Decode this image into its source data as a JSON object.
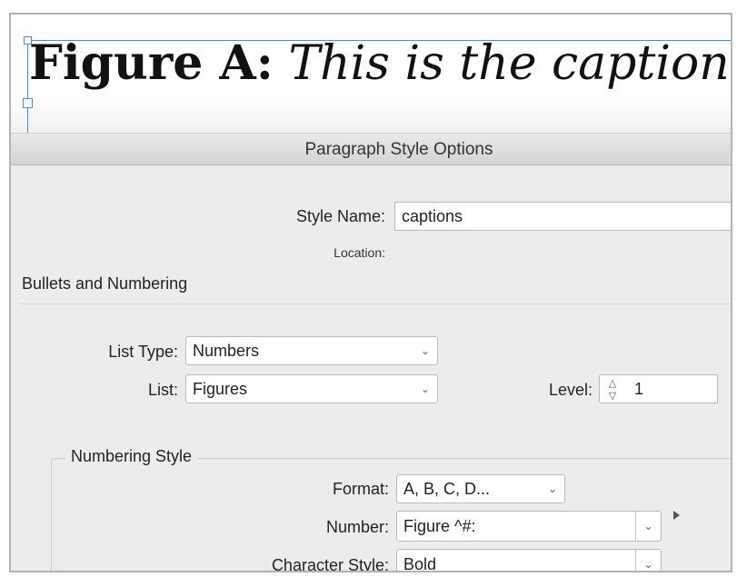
{
  "caption": {
    "label": "Figure A:",
    "text": "This is the caption."
  },
  "dialog": {
    "title": "Paragraph Style Options",
    "style_name_label": "Style Name:",
    "style_name_value": "captions",
    "location_label": "Location:",
    "section_title": "Bullets and Numbering",
    "list_type_label": "List Type:",
    "list_type_value": "Numbers",
    "list_label": "List:",
    "list_value": "Figures",
    "level_label": "Level:",
    "level_value": "1",
    "numbering_style": {
      "group_title": "Numbering Style",
      "format_label": "Format:",
      "format_value": "A, B, C, D...",
      "number_label": "Number:",
      "number_value": "Figure ^#:",
      "char_style_label": "Character Style:",
      "char_style_value": "Bold"
    }
  },
  "icons": {
    "select_arrow": "chevron-down-icon",
    "stepper": "stepper-arrows-icon",
    "flyout": "triangle-right-icon"
  },
  "colors": {
    "frame_selection": "#4a90e2",
    "panel_bg": "#ececec"
  }
}
